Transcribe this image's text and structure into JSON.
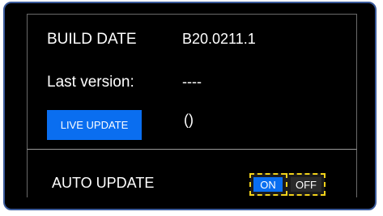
{
  "build": {
    "label": "BUILD DATE",
    "value": "B20.0211.1"
  },
  "last_version": {
    "label": "Last version:",
    "value": "----"
  },
  "live_update": {
    "button_label": "LIVE UPDATE",
    "status": "()"
  },
  "auto_update": {
    "label": "AUTO UPDATE",
    "on_label": "ON",
    "off_label": "OFF",
    "selected": "ON"
  },
  "colors": {
    "background": "#000000",
    "accent": "#0a6ef0",
    "highlight": "#f2d21a",
    "frame_border": "#3a5a9a"
  }
}
